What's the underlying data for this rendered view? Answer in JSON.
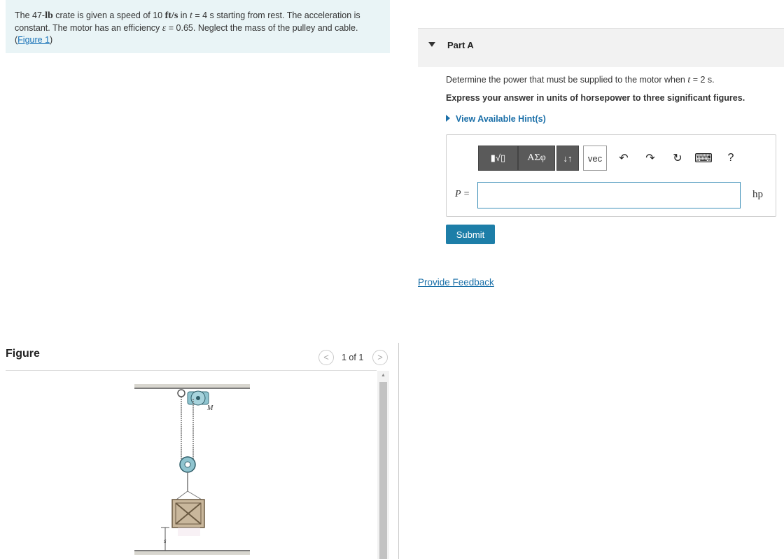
{
  "problem": {
    "text_1": "The 47-",
    "unit_lb": "lb",
    "text_2": " crate is given a speed of 10 ",
    "unit_fts": "ft/s",
    "text_3": " in ",
    "var_t": "t",
    "text_4": " = 4 s starting from rest. The acceleration is constant. The motor has an efficiency ",
    "var_eps": "ε",
    "text_5": " = 0.65. Neglect the mass of the pulley and cable. (",
    "figure_link": "Figure 1",
    "text_6": ")"
  },
  "figure": {
    "label": "Figure",
    "count": "1 of 1",
    "prev_glyph": "<",
    "next_glyph": ">",
    "scroll_up_glyph": "▲",
    "motor_label": "M",
    "s_label": "s"
  },
  "part": {
    "title": "Part A",
    "question_1": "Determine the power that must be supplied to the motor when ",
    "question_var": "t",
    "question_2": " = 2 s.",
    "instruction": "Express your answer in units of horsepower to three significant figures.",
    "hints": "View Available Hint(s)"
  },
  "toolbar": {
    "templates": "▮√▯",
    "greek": "ΑΣφ",
    "arrows": "↓↑",
    "vec": "vec",
    "undo": "↶",
    "redo": "↷",
    "reset": "↻",
    "keyboard": "⌨",
    "help": "?"
  },
  "answer": {
    "label": "P =",
    "value": "",
    "unit": "hp"
  },
  "actions": {
    "submit": "Submit",
    "feedback": "Provide Feedback"
  },
  "colors": {
    "problem_bg": "#e9f4f6",
    "link": "#1a6fa8",
    "submit_bg": "#1d7ea8",
    "toolbar_btn": "#5a5a5a"
  }
}
